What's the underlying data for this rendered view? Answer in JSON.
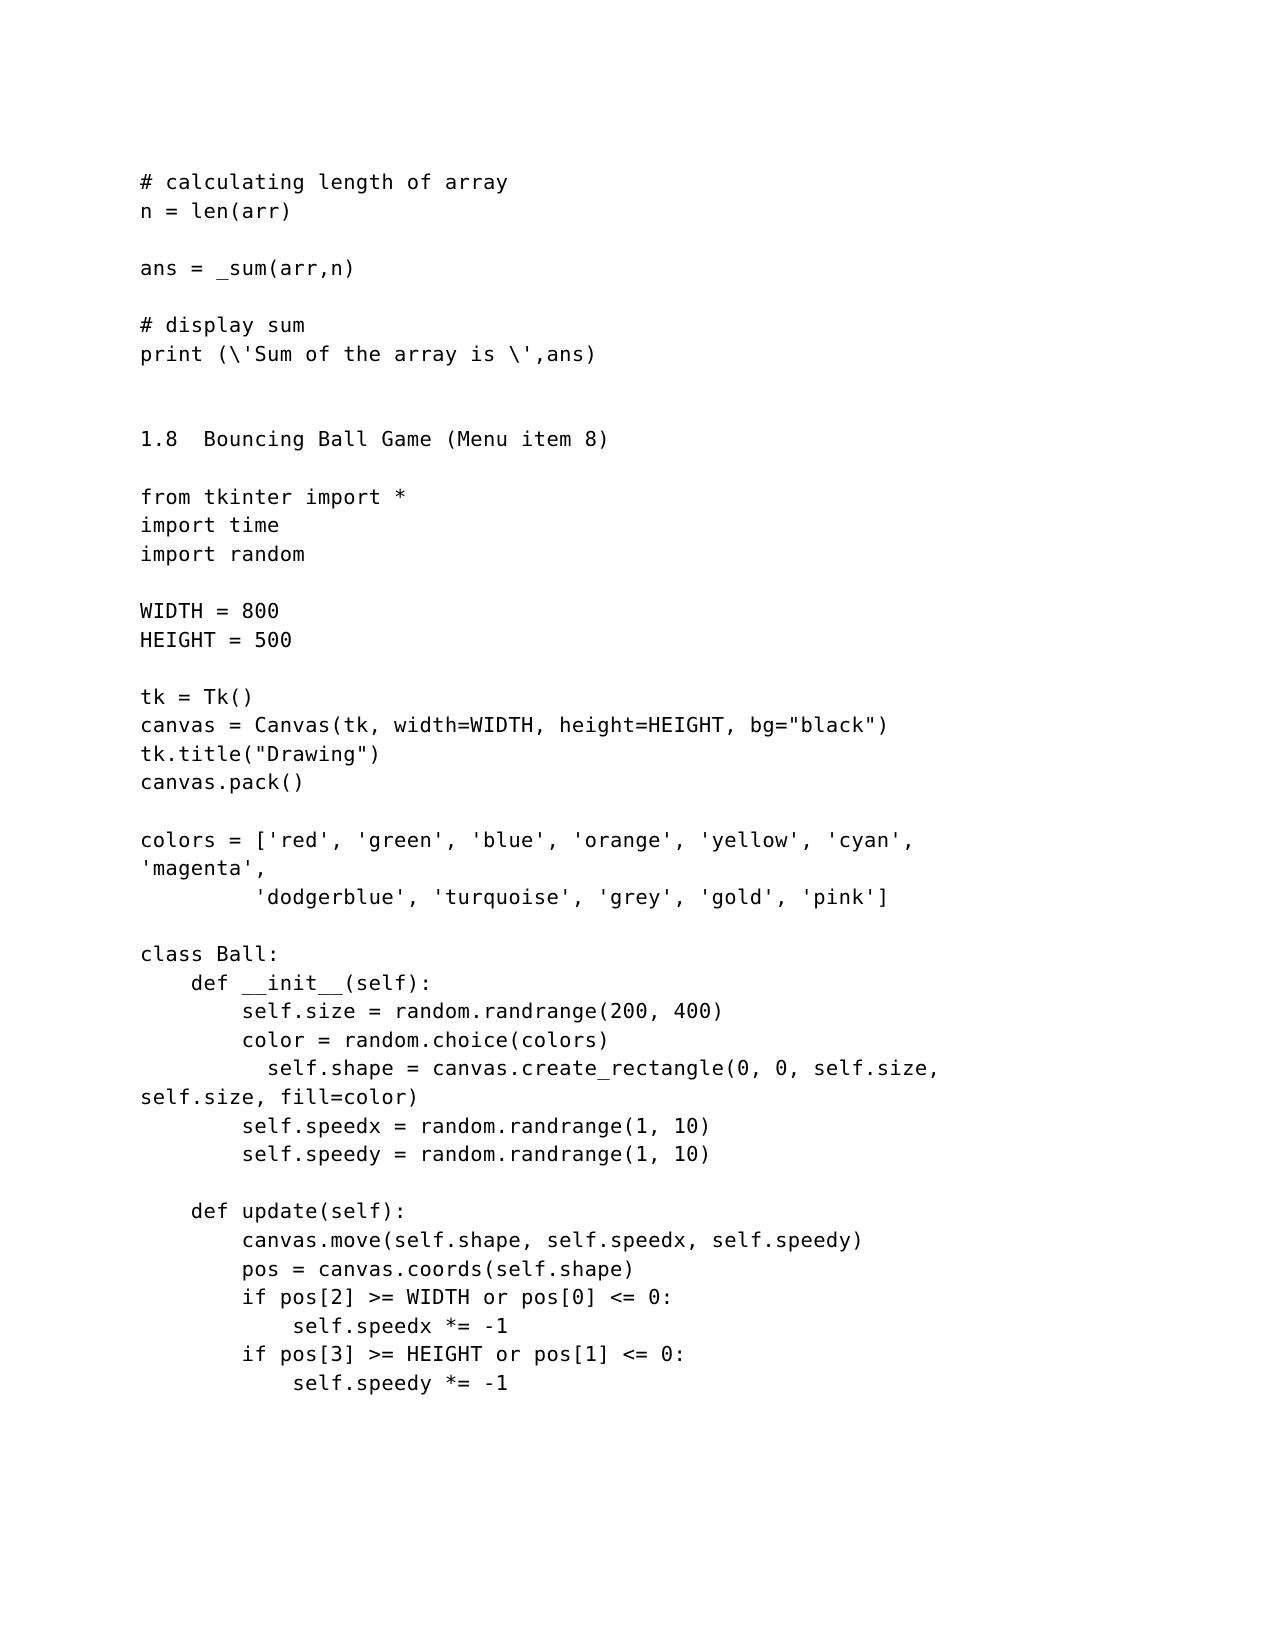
{
  "document": {
    "page_background": "#ffffff",
    "text_color": "#000000",
    "blocks": [
      {
        "name": "array-sum-code-block",
        "lines": [
          "# calculating length of array",
          "n = len(arr)",
          "",
          "ans = _sum(arr,n)",
          "",
          "# display sum",
          "print (\\'Sum of the array is \\',ans)"
        ]
      },
      {
        "name": "section-heading",
        "lines": [
          "",
          "",
          "1.8  Bouncing Ball Game (Menu item 8)"
        ]
      },
      {
        "name": "bouncing-ball-code-block",
        "lines": [
          "",
          "from tkinter import *",
          "import time",
          "import random",
          "",
          "WIDTH = 800",
          "HEIGHT = 500",
          "",
          "tk = Tk()",
          "canvas = Canvas(tk, width=WIDTH, height=HEIGHT, bg=\"black\")",
          "tk.title(\"Drawing\")",
          "canvas.pack()",
          "",
          "colors = ['red', 'green', 'blue', 'orange', 'yellow', 'cyan',",
          "'magenta',",
          "         'dodgerblue', 'turquoise', 'grey', 'gold', 'pink']",
          "",
          "class Ball:",
          "    def __init__(self):",
          "        self.size = random.randrange(200, 400)",
          "        color = random.choice(colors)",
          "          self.shape = canvas.create_rectangle(0, 0, self.size,",
          "self.size, fill=color)",
          "        self.speedx = random.randrange(1, 10)",
          "        self.speedy = random.randrange(1, 10)",
          "",
          "    def update(self):",
          "        canvas.move(self.shape, self.speedx, self.speedy)",
          "        pos = canvas.coords(self.shape)",
          "        if pos[2] >= WIDTH or pos[0] <= 0:",
          "            self.speedx *= -1",
          "        if pos[3] >= HEIGHT or pos[1] <= 0:",
          "            self.speedy *= -1"
        ]
      }
    ],
    "section": {
      "number": "1.8",
      "title": "Bouncing Ball Game (Menu item 8)"
    }
  }
}
